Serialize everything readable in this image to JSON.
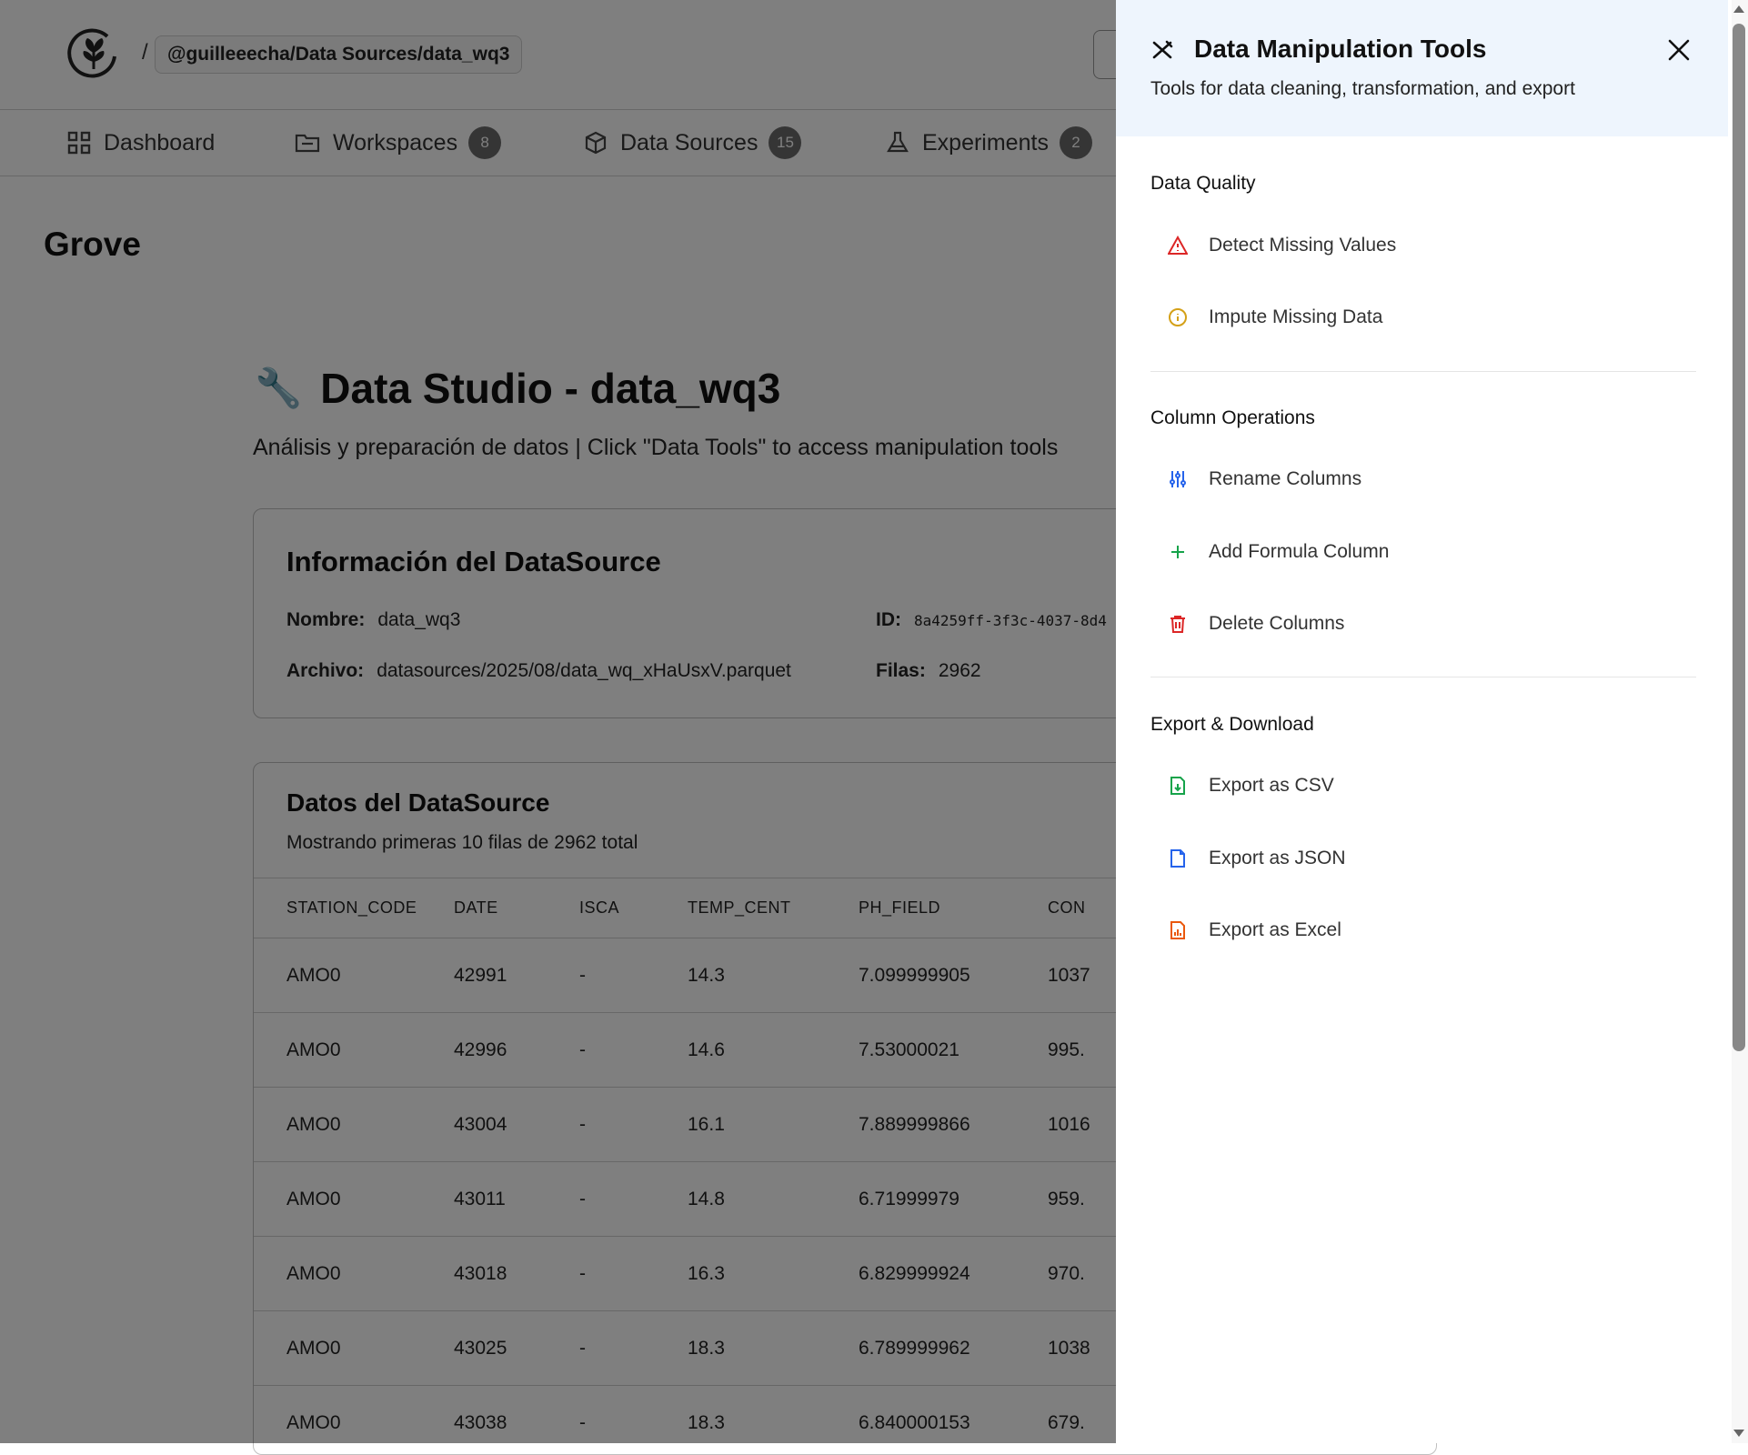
{
  "header": {
    "breadcrumb_sep": "/",
    "breadcrumb": "@guilleeecha/Data Sources/data_wq3"
  },
  "nav": {
    "items": [
      {
        "label": "Dashboard",
        "badge": null,
        "icon": "grid-icon"
      },
      {
        "label": "Workspaces",
        "badge": "8",
        "icon": "folder-icon"
      },
      {
        "label": "Data Sources",
        "badge": "15",
        "icon": "cube-icon"
      },
      {
        "label": "Experiments",
        "badge": "2",
        "icon": "flask-icon"
      }
    ]
  },
  "brand": "Grove",
  "studio": {
    "icon": "wrench-icon",
    "title": "Data Studio - data_wq3",
    "subtitle": "Análisis y preparación de datos | Click \"Data Tools\" to access manipulation tools"
  },
  "info": {
    "title": "Información del DataSource",
    "name_label": "Nombre:",
    "name_value": "data_wq3",
    "id_label": "ID:",
    "id_value": "8a4259ff-3f3c-4037-8d4",
    "file_label": "Archivo:",
    "file_value": "datasources/2025/08/data_wq_xHaUsxV.parquet",
    "rows_label": "Filas:",
    "rows_value": "2962"
  },
  "data_table": {
    "title": "Datos del DataSource",
    "subtitle": "Mostrando primeras 10 filas de 2962 total",
    "columns": [
      "STATION_CODE",
      "DATE",
      "ISCA",
      "TEMP_CENT",
      "PH_FIELD",
      "CON"
    ],
    "rows": [
      [
        "AMO0",
        "42991",
        "-",
        "14.3",
        "7.099999905",
        "1037"
      ],
      [
        "AMO0",
        "42996",
        "-",
        "14.6",
        "7.53000021",
        "995."
      ],
      [
        "AMO0",
        "43004",
        "-",
        "16.1",
        "7.889999866",
        "1016"
      ],
      [
        "AMO0",
        "43011",
        "-",
        "14.8",
        "6.71999979",
        "959."
      ],
      [
        "AMO0",
        "43018",
        "-",
        "16.3",
        "6.829999924",
        "970."
      ],
      [
        "AMO0",
        "43025",
        "-",
        "18.3",
        "6.789999962",
        "1038"
      ],
      [
        "AMO0",
        "43038",
        "-",
        "18.3",
        "6.840000153",
        "679."
      ]
    ]
  },
  "drawer": {
    "title": "Data Manipulation Tools",
    "description": "Tools for data cleaning, transformation, and export",
    "sections": [
      {
        "title": "Data Quality",
        "tools": [
          {
            "label": "Detect Missing Values",
            "icon": "warning-triangle-icon",
            "color": "#dc2626"
          },
          {
            "label": "Impute Missing Data",
            "icon": "info-circle-icon",
            "color": "#d4a017"
          }
        ]
      },
      {
        "title": "Column Operations",
        "tools": [
          {
            "label": "Rename Columns",
            "icon": "sliders-icon",
            "color": "#2563eb"
          },
          {
            "label": "Add Formula Column",
            "icon": "plus-icon",
            "color": "#16a34a"
          },
          {
            "label": "Delete Columns",
            "icon": "trash-icon",
            "color": "#dc2626"
          }
        ]
      },
      {
        "title": "Export & Download",
        "tools": [
          {
            "label": "Export as CSV",
            "icon": "file-download-icon",
            "color": "#16a34a"
          },
          {
            "label": "Export as JSON",
            "icon": "file-icon",
            "color": "#2563eb"
          },
          {
            "label": "Export as Excel",
            "icon": "file-chart-icon",
            "color": "#ea580c"
          }
        ]
      }
    ]
  },
  "colors": {
    "drawer_header_bg": "#eef5fd",
    "overlay": "rgba(0,0,0,0.5)",
    "badge_bg": "#6b6b6b"
  }
}
